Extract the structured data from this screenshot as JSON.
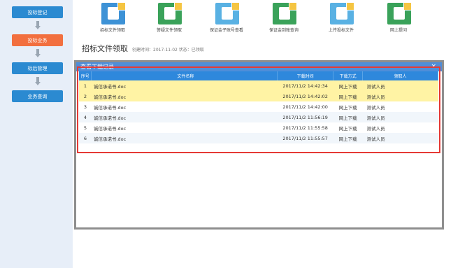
{
  "sidebar": {
    "steps": [
      {
        "label": "投标登记"
      },
      {
        "label": "投标业务"
      },
      {
        "label": "标后管理"
      },
      {
        "label": "业务查询"
      }
    ]
  },
  "toolbar": {
    "items": [
      {
        "label": "招标文件领取",
        "icon": "file-download-icon"
      },
      {
        "label": "答疑文件领取",
        "icon": "document-icon"
      },
      {
        "label": "保证金子账号查看",
        "icon": "calendar-check-icon"
      },
      {
        "label": "保证金到账查询",
        "icon": "transfer-icon"
      },
      {
        "label": "上传投标文件",
        "icon": "upload-tray-icon"
      },
      {
        "label": "网上提问",
        "icon": "search-document-icon"
      }
    ]
  },
  "page": {
    "title": "招标文件领取",
    "meta": "创建时间：2017-11-02  状态：已领取"
  },
  "modal": {
    "title": "查看下载记录",
    "close": "×",
    "columns": [
      "序号",
      "文件名称",
      "下载时间",
      "下载方式",
      "领取人"
    ],
    "rows": [
      {
        "no": "1",
        "name": "诚信承诺书.doc",
        "time": "2017/11/2 14:42:34",
        "way": "网上下载",
        "who": "测试人员"
      },
      {
        "no": "2",
        "name": "诚信承诺书.doc",
        "time": "2017/11/2 14:42:02",
        "way": "网上下载",
        "who": "测试人员"
      },
      {
        "no": "3",
        "name": "诚信承诺书.doc",
        "time": "2017/11/2 14:42:00",
        "way": "网上下载",
        "who": "测试人员"
      },
      {
        "no": "4",
        "name": "诚信承诺书.doc",
        "time": "2017/11/2 11:56:19",
        "way": "网上下载",
        "who": "测试人员"
      },
      {
        "no": "5",
        "name": "诚信承诺书.doc",
        "time": "2017/11/2 11:55:58",
        "way": "网上下载",
        "who": "测试人员"
      },
      {
        "no": "6",
        "name": "诚信承诺书.doc",
        "time": "2017/11/2 11:55:57",
        "way": "网上下载",
        "who": "测试人员"
      }
    ]
  },
  "colors": {
    "step_blue": "#2b8ad1",
    "step_active": "#f26f3f",
    "table_header": "#2e88dc",
    "highlight_row": "#fff3a4",
    "annotation_frame": "#e53935"
  }
}
